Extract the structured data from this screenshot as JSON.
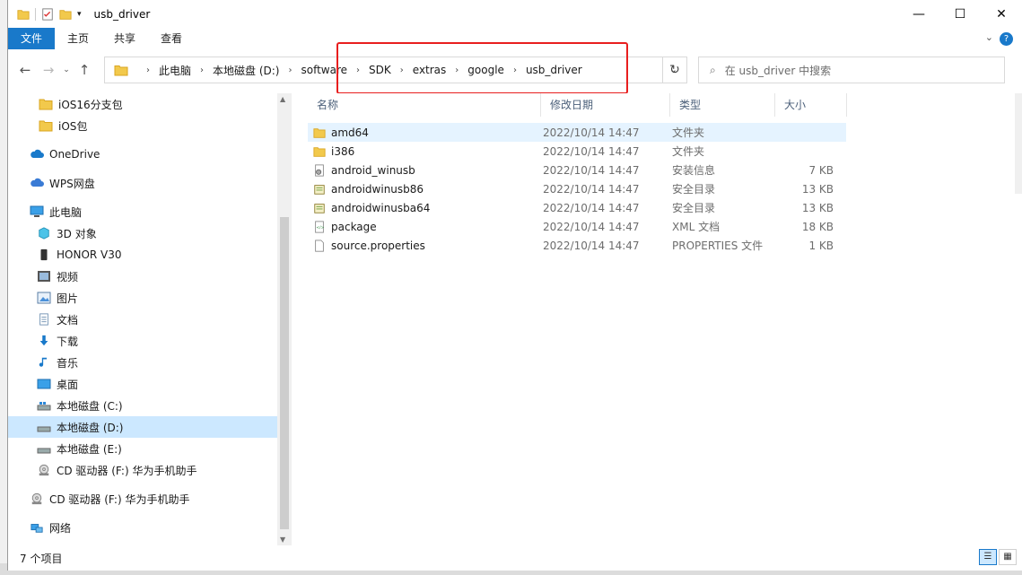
{
  "window": {
    "title": "usb_driver"
  },
  "ribbon": {
    "tabs": [
      {
        "label": "文件"
      },
      {
        "label": "主页"
      },
      {
        "label": "共享"
      },
      {
        "label": "查看"
      }
    ],
    "help": "?"
  },
  "address": {
    "crumbs": [
      "此电脑",
      "本地磁盘 (D:)",
      "software",
      "SDK",
      "extras",
      "google",
      "usb_driver"
    ]
  },
  "search": {
    "placeholder": "在 usb_driver 中搜索"
  },
  "sidebar": {
    "items": [
      {
        "label": "iOS16分支包",
        "icon": "folder-icon"
      },
      {
        "label": "iOS包",
        "icon": "folder-icon"
      },
      {
        "label": "OneDrive",
        "icon": "cloud-icon"
      },
      {
        "label": "WPS网盘",
        "icon": "cloud-icon"
      },
      {
        "label": "此电脑",
        "icon": "computer-icon"
      },
      {
        "label": "3D 对象",
        "icon": "cube-icon"
      },
      {
        "label": "HONOR V30",
        "icon": "phone-icon"
      },
      {
        "label": "视频",
        "icon": "video-icon"
      },
      {
        "label": "图片",
        "icon": "picture-icon"
      },
      {
        "label": "文档",
        "icon": "document-icon"
      },
      {
        "label": "下载",
        "icon": "download-icon"
      },
      {
        "label": "音乐",
        "icon": "music-icon"
      },
      {
        "label": "桌面",
        "icon": "desktop-icon"
      },
      {
        "label": "本地磁盘 (C:)",
        "icon": "drive-icon"
      },
      {
        "label": "本地磁盘 (D:)",
        "icon": "drive-icon"
      },
      {
        "label": "本地磁盘 (E:)",
        "icon": "drive-icon"
      },
      {
        "label": "CD 驱动器 (F:) 华为手机助手",
        "icon": "cd-icon"
      },
      {
        "label": "CD 驱动器 (F:) 华为手机助手",
        "icon": "cd-icon"
      },
      {
        "label": "网络",
        "icon": "network-icon"
      }
    ]
  },
  "columns": {
    "name": "名称",
    "date": "修改日期",
    "type": "类型",
    "size": "大小"
  },
  "files": [
    {
      "name": "amd64",
      "date": "2022/10/14 14:47",
      "type": "文件夹",
      "size": "",
      "icon": "folder-icon"
    },
    {
      "name": "i386",
      "date": "2022/10/14 14:47",
      "type": "文件夹",
      "size": "",
      "icon": "folder-icon"
    },
    {
      "name": "android_winusb",
      "date": "2022/10/14 14:47",
      "type": "安装信息",
      "size": "7 KB",
      "icon": "setup-info-icon"
    },
    {
      "name": "androidwinusb86",
      "date": "2022/10/14 14:47",
      "type": "安全目录",
      "size": "13 KB",
      "icon": "security-catalog-icon"
    },
    {
      "name": "androidwinusba64",
      "date": "2022/10/14 14:47",
      "type": "安全目录",
      "size": "13 KB",
      "icon": "security-catalog-icon"
    },
    {
      "name": "package",
      "date": "2022/10/14 14:47",
      "type": "XML 文档",
      "size": "18 KB",
      "icon": "xml-file-icon"
    },
    {
      "name": "source.properties",
      "date": "2022/10/14 14:47",
      "type": "PROPERTIES 文件",
      "size": "1 KB",
      "icon": "file-icon"
    }
  ],
  "status": {
    "count": "7 个项目"
  }
}
